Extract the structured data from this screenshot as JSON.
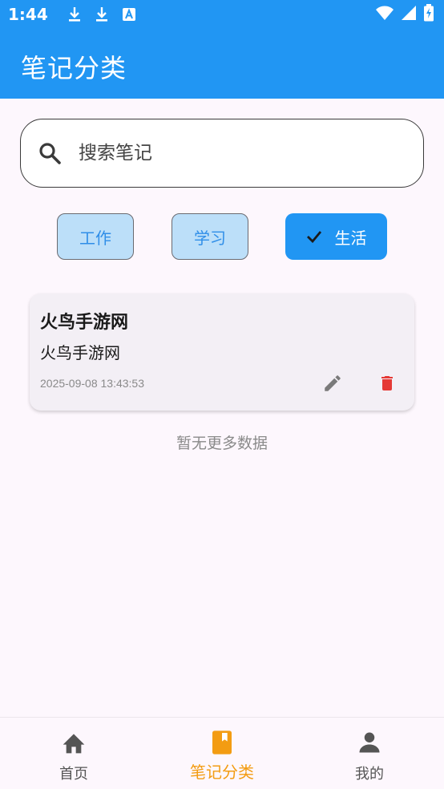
{
  "status_bar": {
    "time": "1:44",
    "icons": [
      "download-icon",
      "download-icon",
      "text-a-icon",
      "wifi-icon",
      "signal-icon",
      "battery-icon"
    ]
  },
  "header": {
    "title": "笔记分类"
  },
  "search": {
    "placeholder": "搜索笔记",
    "value": ""
  },
  "categories": [
    {
      "label": "工作",
      "selected": false
    },
    {
      "label": "学习",
      "selected": false
    },
    {
      "label": "生活",
      "selected": true
    }
  ],
  "notes": [
    {
      "title": "火鸟手游网",
      "content": "火鸟手游网",
      "time": "2025-09-08 13:43:53"
    }
  ],
  "list_footer": "暂无更多数据",
  "bottom_nav": {
    "items": [
      {
        "label": "首页",
        "icon": "home-icon",
        "active": false
      },
      {
        "label": "笔记分类",
        "icon": "book-icon",
        "active": true
      },
      {
        "label": "我的",
        "icon": "person-icon",
        "active": false
      }
    ]
  },
  "colors": {
    "primary": "#2196f3",
    "chip_outline_bg": "#bcdff9",
    "accent_orange": "#f39c12",
    "delete_red": "#e53935",
    "background": "#fdf7fd"
  }
}
